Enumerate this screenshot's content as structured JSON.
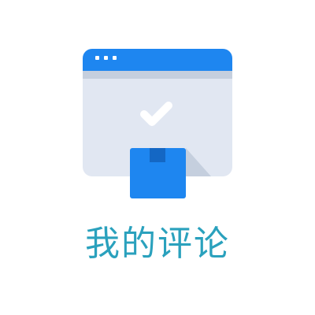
{
  "card": {
    "title": "我的评论",
    "illustration_icon": "browser-window-with-checkmark-and-package-icon"
  },
  "colors": {
    "accent": "#1E86F0",
    "caption": "#2AA1BD",
    "window_body": "#E1E7F2",
    "window_shadow": "#C5CFDE",
    "package": "#1E86F0",
    "package_tape": "#1467C4",
    "checkmark": "#FFFFFF"
  }
}
